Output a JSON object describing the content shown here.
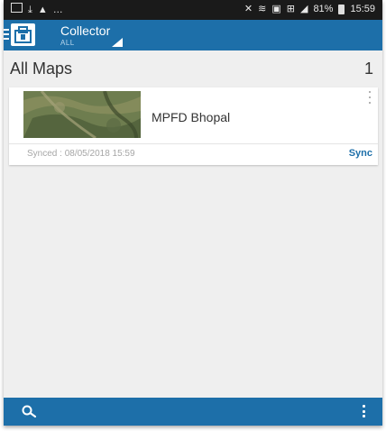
{
  "status_bar": {
    "left_icons": [
      "image-icon",
      "download-icon",
      "warning-icon",
      "more-dots-icon"
    ],
    "right_icons": [
      "mute-icon",
      "wifi-icon",
      "nfc-icon",
      "lte-icon",
      "signal-icon"
    ],
    "battery": "81%",
    "time": "15:59"
  },
  "app_bar": {
    "title": "Collector",
    "subtitle": "ALL",
    "accent_color": "#1d6fa9"
  },
  "section": {
    "title": "All Maps",
    "count": "1"
  },
  "maps": [
    {
      "name": "MPFD Bhopal",
      "sync_label": "Synced :",
      "sync_time": "08/05/2018 15:59",
      "action_label": "Sync"
    }
  ],
  "bottom_bar": {
    "icons": [
      "search-icon",
      "more-vert-icon"
    ]
  }
}
